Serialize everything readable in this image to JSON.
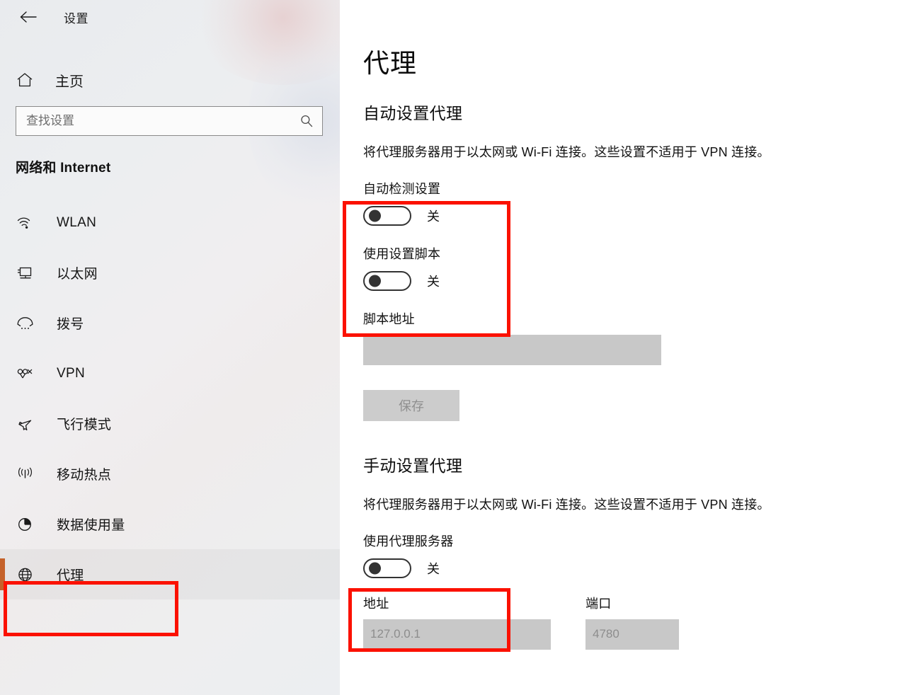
{
  "window": {
    "title": "设置",
    "back_icon": "back-arrow-icon"
  },
  "sidebar": {
    "home": {
      "label": "主页",
      "icon": "home-icon"
    },
    "search": {
      "placeholder": "查找设置",
      "value": "",
      "icon": "search-icon"
    },
    "category": "网络和 Internet",
    "items": [
      {
        "label": "WLAN",
        "icon": "wifi-icon",
        "selected": false
      },
      {
        "label": "以太网",
        "icon": "ethernet-icon",
        "selected": false
      },
      {
        "label": "拨号",
        "icon": "dialup-phone-icon",
        "selected": false
      },
      {
        "label": "VPN",
        "icon": "vpn-icon",
        "selected": false
      },
      {
        "label": "飞行模式",
        "icon": "airplane-icon",
        "selected": false
      },
      {
        "label": "移动热点",
        "icon": "hotspot-icon",
        "selected": false
      },
      {
        "label": "数据使用量",
        "icon": "data-usage-icon",
        "selected": false
      },
      {
        "label": "代理",
        "icon": "globe-icon",
        "selected": true
      }
    ]
  },
  "main": {
    "page_title": "代理",
    "auto_section": {
      "heading": "自动设置代理",
      "description": "将代理服务器用于以太网或 Wi-Fi 连接。这些设置不适用于 VPN 连接。",
      "auto_detect": {
        "label": "自动检测设置",
        "state": "关",
        "on": false
      },
      "use_script": {
        "label": "使用设置脚本",
        "state": "关",
        "on": false
      },
      "script_address": {
        "label": "脚本地址",
        "value": "",
        "placeholder": ""
      },
      "save_label": "保存"
    },
    "manual_section": {
      "heading": "手动设置代理",
      "description": "将代理服务器用于以太网或 Wi-Fi 连接。这些设置不适用于 VPN 连接。",
      "use_proxy": {
        "label": "使用代理服务器",
        "state": "关",
        "on": false
      },
      "address": {
        "label": "地址",
        "value": "127.0.0.1"
      },
      "port": {
        "label": "端口",
        "value": "4780"
      }
    }
  },
  "annotations": {
    "accent_color": "#c5622a",
    "highlight_color": "#fb1100",
    "boxes": [
      {
        "name": "auto-proxy-toggles-highlight"
      },
      {
        "name": "manual-proxy-toggle-highlight"
      },
      {
        "name": "sidebar-proxy-item-highlight"
      }
    ]
  }
}
